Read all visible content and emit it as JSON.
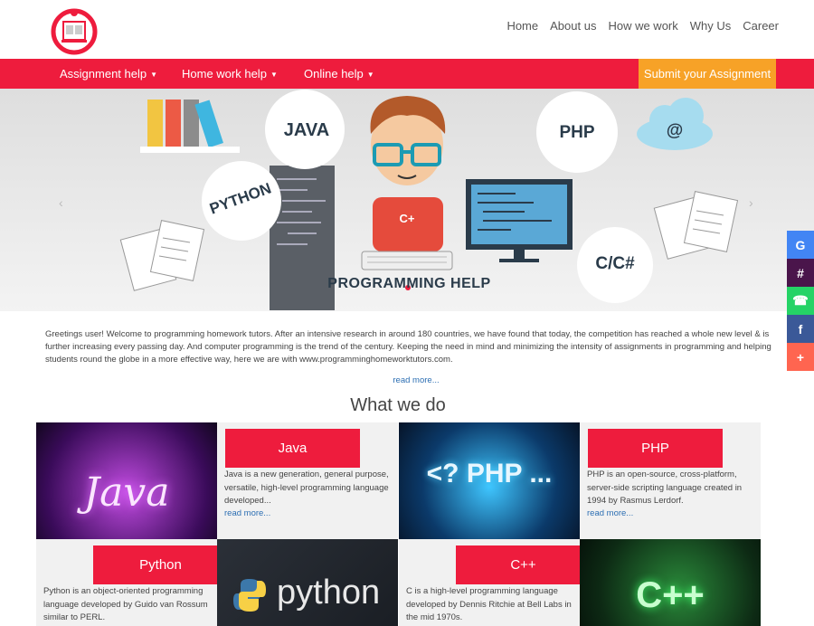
{
  "topnav": [
    "Home",
    "About us",
    "How we work",
    "Why Us",
    "Career"
  ],
  "menu": {
    "items": [
      "Assignment help",
      "Home work help",
      "Online help"
    ],
    "submit_label": "Submit your Assignment"
  },
  "hero": {
    "languages": [
      "JAVA",
      "PHP",
      "PYTHON",
      "C/C#"
    ],
    "cloud_symbol": "@",
    "shirt_symbol": "C+",
    "caption": "PROGRAMMING HELP"
  },
  "intro": {
    "text": "Greetings user! Welcome to programming homework tutors. After an intensive research in around 180 countries, we have found that today, the competition has reached a whole new level & is further increasing every passing day. And computer programming is the trend of the century. Keeping the need in mind and minimizing the intensity of assignments in programming and helping students round the globe in a more effective way, here we are with www.programminghomeworktutors.com.",
    "read_more": "read more..."
  },
  "section_title": "What we do",
  "tiles": {
    "java": {
      "title": "Java",
      "desc": "Java is a new generation, general purpose, versatile, high-level programming language developed...",
      "more": "read more...",
      "image_text": "Java"
    },
    "php": {
      "title": "PHP",
      "desc": "PHP is an open-source, cross-platform, server-side scripting language created in 1994 by Rasmus Lerdorf.",
      "more": "read more...",
      "image_text": "<? PHP ..."
    },
    "python": {
      "title": "Python",
      "desc": "Python is an object-oriented programming language developed by Guido van Rossum similar to PERL.",
      "image_text": "python"
    },
    "cpp": {
      "title": "C++",
      "desc": "C is a high-level programming language developed by Dennis Ritchie at Bell Labs in the mid 1970s.",
      "image_text": "C++"
    }
  },
  "share": [
    {
      "icon": "google-icon",
      "glyph": "G",
      "color": "#4285f4"
    },
    {
      "icon": "slack-icon",
      "glyph": "#",
      "color": "#4a154b"
    },
    {
      "icon": "whatsapp-icon",
      "glyph": "☎",
      "color": "#25d366"
    },
    {
      "icon": "facebook-icon",
      "glyph": "f",
      "color": "#3b5998"
    },
    {
      "icon": "plus-icon",
      "glyph": "+",
      "color": "#ff6550"
    }
  ],
  "colors": {
    "brand_red": "#ee1c3d",
    "orange": "#f7a227",
    "link": "#2d6fb3"
  }
}
